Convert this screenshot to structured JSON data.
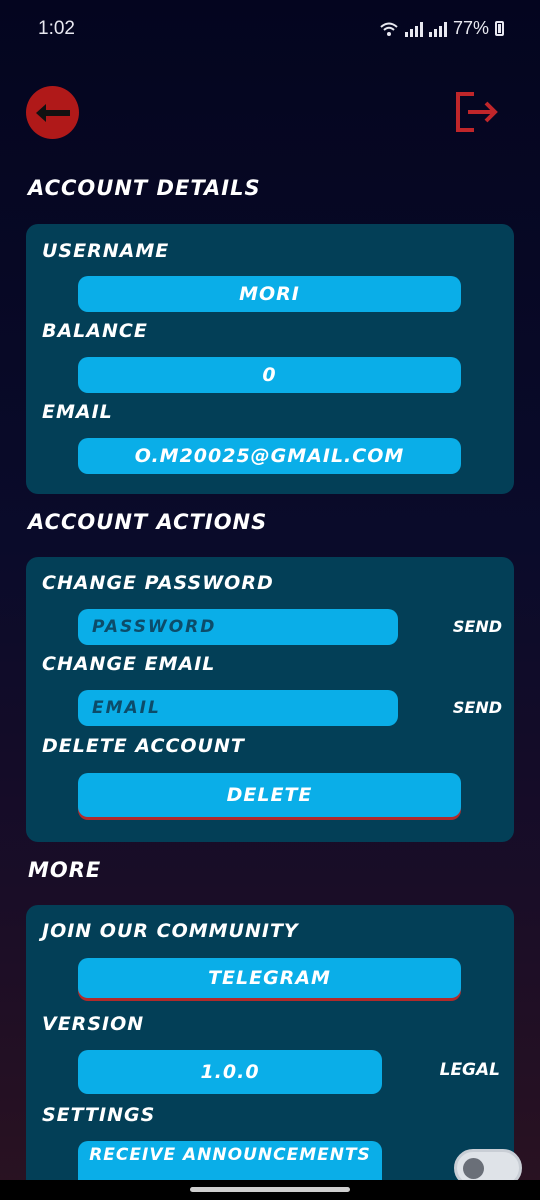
{
  "status_bar": {
    "time": "1:02",
    "battery": "77%",
    "icons": [
      "wifi-icon",
      "signal-icon",
      "signal-icon",
      "battery-icon"
    ]
  },
  "header": {
    "back_icon": "arrow-left-icon",
    "logout_icon": "logout-icon",
    "accent_color": "#b01919"
  },
  "account_details": {
    "title": "ACCOUNT DETAILS",
    "username_label": "USERNAME",
    "username_value": "MORI",
    "balance_label": "BALANCE",
    "balance_value": "0",
    "email_label": "EMAIL",
    "email_value": "O.M20025@GMAIL.COM"
  },
  "account_actions": {
    "title": "ACCOUNT ACTIONS",
    "change_password_label": "CHANGE PASSWORD",
    "password_placeholder": "PASSWORD",
    "password_send": "SEND",
    "change_email_label": "CHANGE EMAIL",
    "email_placeholder": "EMAIL",
    "email_send": "SEND",
    "delete_label": "DELETE ACCOUNT",
    "delete_button": "DELETE"
  },
  "more": {
    "title": "MORE",
    "community_label": "JOIN OUR COMMUNITY",
    "telegram_button": "TELEGRAM",
    "version_label": "VERSION",
    "version_value": "1.0.0",
    "legal_link": "LEGAL",
    "settings_label": "SETTINGS",
    "announcements_button": "RECEIVE ANNOUNCEMENTS",
    "announcements_toggle": false
  },
  "colors": {
    "card": "#033f57",
    "pill": "#0aaee8",
    "background": "#04051f"
  }
}
